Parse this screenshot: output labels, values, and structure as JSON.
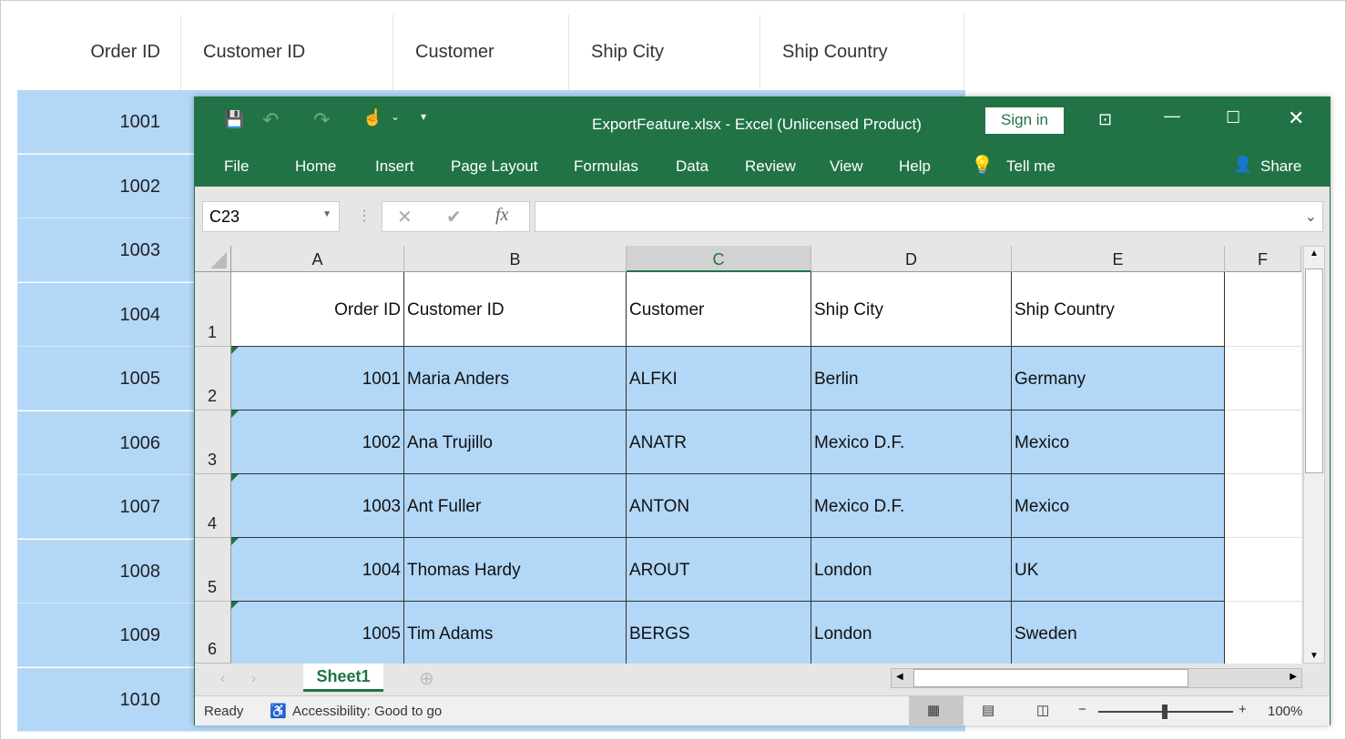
{
  "background_grid": {
    "headers": [
      "Order ID",
      "Customer ID",
      "Customer",
      "Ship City",
      "Ship Country"
    ],
    "order_ids": [
      "1001",
      "1002",
      "1003",
      "1004",
      "1005",
      "1006",
      "1007",
      "1008",
      "1009",
      "1010"
    ]
  },
  "excel": {
    "title": "ExportFeature.xlsx  -  Excel (Unlicensed Product)",
    "sign_in": "Sign in",
    "menu": [
      "File",
      "Home",
      "Insert",
      "Page Layout",
      "Formulas",
      "Data",
      "Review",
      "View",
      "Help"
    ],
    "tell_me": "Tell me",
    "share": "Share",
    "name_box": "C23",
    "fx": "fx",
    "columns": [
      "A",
      "B",
      "C",
      "D",
      "E",
      "F"
    ],
    "rows": [
      "1",
      "2",
      "3",
      "4",
      "5",
      "6"
    ],
    "header": [
      "Order ID",
      "Customer ID",
      "Customer",
      "Ship City",
      "Ship Country"
    ],
    "data": [
      [
        "1001",
        "Maria Anders",
        "ALFKI",
        "Berlin",
        "Germany"
      ],
      [
        "1002",
        "Ana Trujillo",
        "ANATR",
        "Mexico D.F.",
        "Mexico"
      ],
      [
        "1003",
        "Ant Fuller",
        "ANTON",
        "Mexico D.F.",
        "Mexico"
      ],
      [
        "1004",
        "Thomas Hardy",
        "AROUT",
        "London",
        "UK"
      ],
      [
        "1005",
        "Tim Adams",
        "BERGS",
        "London",
        "Sweden"
      ]
    ],
    "sheet_tab": "Sheet1",
    "status": "Ready",
    "accessibility": "Accessibility: Good to go",
    "zoom": "100%",
    "colors": {
      "accent": "#217346",
      "selection": "#b3d7f7"
    }
  }
}
